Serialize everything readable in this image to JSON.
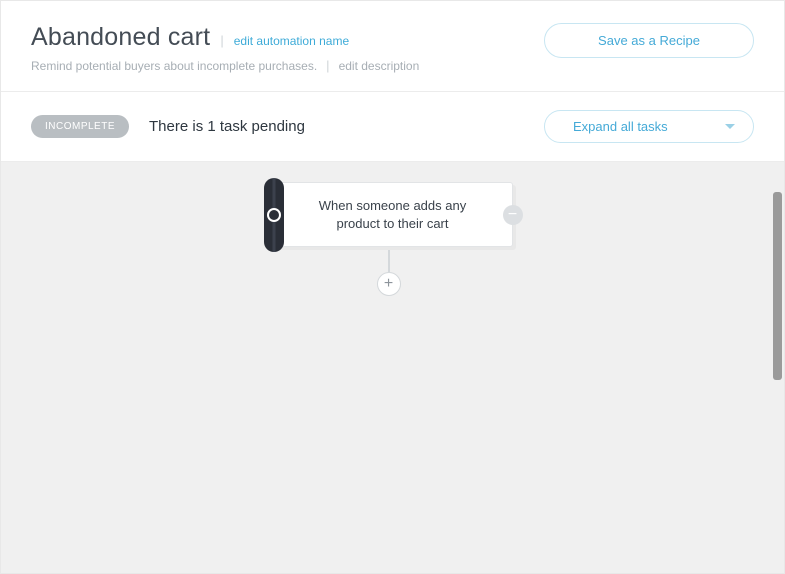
{
  "header": {
    "title": "Abandoned cart",
    "edit_name_link": "edit automation name",
    "subtitle": "Remind potential buyers about incomplete purchases.",
    "edit_description_link": "edit description",
    "save_recipe_label": "Save as a Recipe"
  },
  "status": {
    "badge": "INCOMPLETE",
    "pending_text": "There is 1 task pending",
    "expand_label": "Expand all tasks"
  },
  "workflow": {
    "trigger_node": {
      "text": "When someone adds any product to their cart"
    },
    "remove_glyph": "−",
    "add_glyph": "+"
  }
}
